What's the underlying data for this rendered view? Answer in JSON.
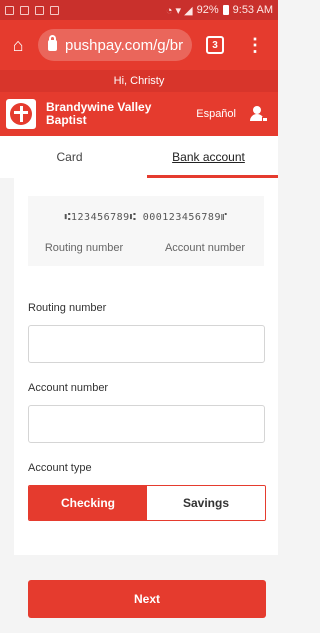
{
  "status_bar": {
    "battery": "92%",
    "time": "9:53 AM"
  },
  "browser": {
    "url": "pushpay.com/g/br",
    "tab_count": "3"
  },
  "greeting": "Hi, Christy",
  "org": {
    "name": "Brandywine Valley Baptist",
    "language_link": "Español"
  },
  "tabs": [
    {
      "label": "Card",
      "active": false
    },
    {
      "label": "Bank account",
      "active": true
    }
  ],
  "check_sample": {
    "micr_line": "⑆123456789⑆ 000123456789⑈",
    "routing_caption": "Routing number",
    "account_caption": "Account number"
  },
  "form": {
    "routing_label": "Routing number",
    "account_label": "Account number",
    "account_type_label": "Account type",
    "account_types": [
      "Checking",
      "Savings"
    ],
    "selected_account_type": "Checking"
  },
  "next_button": "Next",
  "colors": {
    "brand_red": "#e53b2e",
    "status_bar": "#c9302c"
  }
}
